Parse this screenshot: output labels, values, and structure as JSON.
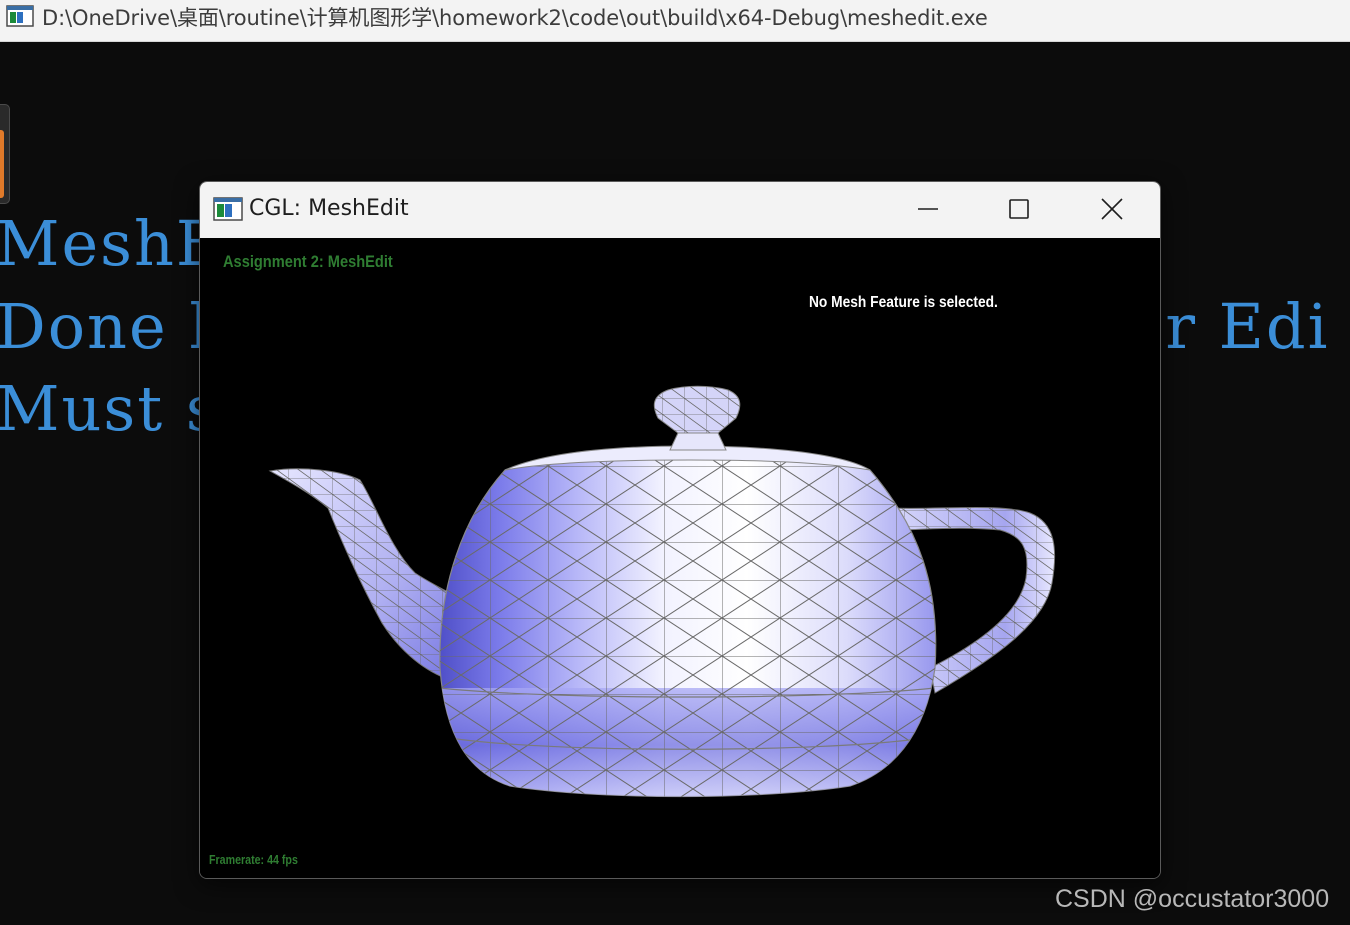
{
  "console": {
    "title": "D:\\OneDrive\\桌面\\routine\\计算机图形学\\homework2\\code\\out\\build\\x64-Debug\\meshedit.exe",
    "icon": "console-window-icon",
    "lines": [
      "MeshEd",
      "Done l",
      "Must s"
    ],
    "line2_tail": "or Edi",
    "text_color": "#3b8ed8"
  },
  "cgl_window": {
    "title": "CGL: MeshEdit",
    "icon": "app-window-icon",
    "controls": {
      "minimize": "minimize-icon",
      "maximize": "maximize-icon",
      "close": "close-icon"
    },
    "overlay": {
      "assignment": "Assignment 2: MeshEdit",
      "selection_status": "No Mesh Feature is selected.",
      "framerate": "Framerate: 44 fps",
      "label_color": "#2f7d32"
    },
    "viewport": {
      "model": "teapot-mesh",
      "mesh_color": "#8a8af5",
      "wireframe_color": "#6a6a6a"
    }
  },
  "watermark": "CSDN @occustator3000"
}
